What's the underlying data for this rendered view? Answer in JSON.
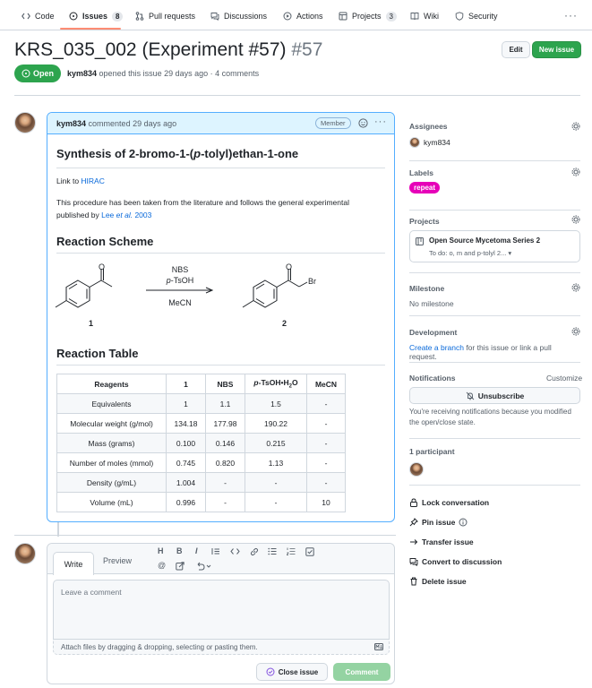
{
  "nav": {
    "tabs": [
      {
        "label": "Code",
        "icon": "code-icon"
      },
      {
        "label": "Issues",
        "icon": "issue-icon",
        "count": "8"
      },
      {
        "label": "Pull requests",
        "icon": "pull-request-icon"
      },
      {
        "label": "Discussions",
        "icon": "discussion-icon"
      },
      {
        "label": "Actions",
        "icon": "play-icon"
      },
      {
        "label": "Projects",
        "icon": "table-icon",
        "count": "3"
      },
      {
        "label": "Wiki",
        "icon": "book-icon"
      },
      {
        "label": "Security",
        "icon": "shield-icon"
      }
    ],
    "more": "···"
  },
  "issue": {
    "title": "KRS_035_002 (Experiment #57)",
    "number": "#57",
    "state": "Open",
    "author": "kym834",
    "meta_rest": "opened this issue 29 days ago · 4 comments",
    "edit_label": "Edit",
    "new_issue_label": "New issue"
  },
  "comment": {
    "author": "kym834",
    "when": "commented 29 days ago",
    "role": "Member",
    "heading_pre": "Synthesis of 2-bromo-1-(",
    "heading_it": "p",
    "heading_post": "-tolyl)ethan-1-one",
    "link_pre": "Link to ",
    "link_text": "HIRAC",
    "proc_pre": "This procedure has been taken from the literature and follows the general experimental",
    "proc_line2_pre": "published by ",
    "proc_link_a": "Lee ",
    "proc_link_b": "et al.",
    "proc_link_c": " 2003",
    "scheme_heading": "Reaction Scheme",
    "table_heading": "Reaction Table",
    "scheme": {
      "reagent_top": "NBS",
      "reagent_mid_it": "p",
      "reagent_mid": "-TsOH",
      "reagent_bottom": "MeCN",
      "label_1": "1",
      "label_2": "2",
      "o1": "O",
      "o2": "O",
      "br": "Br"
    },
    "table": {
      "headers": [
        "Reagents",
        "1",
        "NBS",
        "p-TsOH•H2O",
        "MeCN"
      ],
      "rows": [
        [
          "Equivalents",
          "1",
          "1.1",
          "1.5",
          "-"
        ],
        [
          "Molecular weight (g/mol)",
          "134.18",
          "177.98",
          "190.22",
          "-"
        ],
        [
          "Mass (grams)",
          "0.100",
          "0.146",
          "0.215",
          "-"
        ],
        [
          "Number of moles (mmol)",
          "0.745",
          "0.820",
          "1.13",
          "-"
        ],
        [
          "Density (g/mL)",
          "1.004",
          "-",
          "-",
          "-"
        ],
        [
          "Volume (mL)",
          "0.996",
          "-",
          "-",
          "10"
        ]
      ]
    }
  },
  "editor": {
    "write_tab": "Write",
    "preview_tab": "Preview",
    "placeholder": "Leave a comment",
    "attach_text": "Attach files by dragging & dropping, selecting or pasting them.",
    "close_issue_label": "Close issue",
    "comment_label": "Comment",
    "toolbar": [
      "H",
      "B",
      "I",
      "quote",
      "code",
      "link",
      "ul",
      "ol",
      "task",
      "@",
      "ref",
      "undo"
    ]
  },
  "sidebar": {
    "assignees_title": "Assignees",
    "assignee": "kym834",
    "labels_title": "Labels",
    "label": "repeat",
    "label_color": "#e600b8",
    "projects_title": "Projects",
    "project_name": "Open Source Mycetoma Series 2",
    "project_status": "To do: o, m and p-tolyl 2...",
    "milestone_title": "Milestone",
    "milestone_value": "No milestone",
    "development_title": "Development",
    "dev_link": "Create a branch",
    "dev_rest": " for this issue or link a pull request.",
    "notifications_title": "Notifications",
    "customize": "Customize",
    "unsubscribe": "Unsubscribe",
    "notif_text_1": "You're receiving notifications because you modified",
    "notif_text_2": "the open/close state.",
    "participants_title": "1 participant",
    "actions": [
      "Lock conversation",
      "Pin issue",
      "Transfer issue",
      "Convert to discussion",
      "Delete issue"
    ]
  },
  "colors": {
    "accent_green": "#2da44e",
    "link_blue": "#0969da",
    "comment_border": "#54aeff",
    "comment_header": "#ddf4ff",
    "tab_underline": "#fd8c73"
  }
}
